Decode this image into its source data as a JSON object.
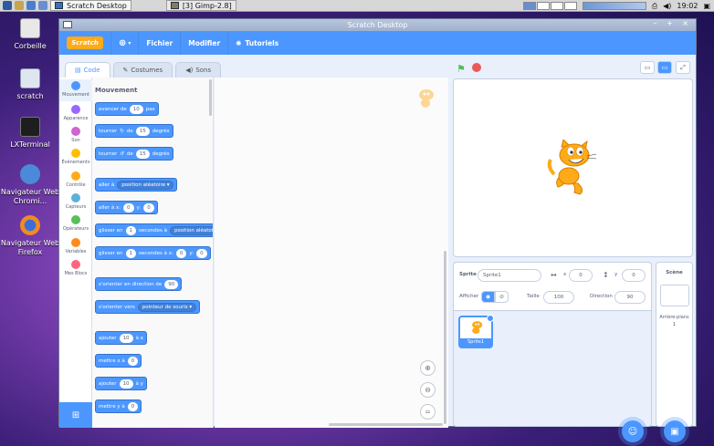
{
  "taskbar": {
    "tasks": [
      "Scratch Desktop",
      "[3] Gimp-2.8]"
    ],
    "clock": "19:02"
  },
  "desktop": {
    "icons": [
      "Corbeille",
      "scratch",
      "LXTerminal",
      "Navigateur Web Chromi...",
      "Navigateur Web Firefox"
    ]
  },
  "window": {
    "title": "Scratch Desktop",
    "controls": "– + ×"
  },
  "menu": {
    "logo": "Scratch",
    "file": "Fichier",
    "edit": "Modifier",
    "tutorials": "Tutoriels"
  },
  "tabs": [
    "Code",
    "Costumes",
    "Sons"
  ],
  "categories": [
    {
      "label": "Mouvement",
      "color": "#4c97ff"
    },
    {
      "label": "Apparence",
      "color": "#9966ff"
    },
    {
      "label": "Son",
      "color": "#cf63cf"
    },
    {
      "label": "Événements",
      "color": "#ffbf00"
    },
    {
      "label": "Contrôle",
      "color": "#ffab19"
    },
    {
      "label": "Capteurs",
      "color": "#5cb1d6"
    },
    {
      "label": "Opérateurs",
      "color": "#59c059"
    },
    {
      "label": "Variables",
      "color": "#ff8c1a"
    },
    {
      "label": "Mes Blocs",
      "color": "#ff6680"
    }
  ],
  "palette": {
    "title": "Mouvement",
    "blocks": {
      "move": [
        "avancer de",
        "10",
        "pas"
      ],
      "turn_right": [
        "tourner",
        "de",
        "15",
        "degrés"
      ],
      "turn_left": [
        "tourner",
        "de",
        "15",
        "degrés"
      ],
      "goto": [
        "aller à",
        "position aléatoire"
      ],
      "goto_xy": [
        "aller à x:",
        "0",
        "y:",
        "0"
      ],
      "glide": [
        "glisser en",
        "1",
        "secondes à",
        "position aléatoire"
      ],
      "glide_xy": [
        "glisser en",
        "1",
        "secondes à x:",
        "0",
        "y:",
        "0"
      ],
      "point_dir": [
        "s'orienter en direction de",
        "90"
      ],
      "point_towards": [
        "s'orienter vers",
        "pointeur de souris"
      ],
      "change_x": [
        "ajouter",
        "10",
        "à x"
      ],
      "set_x": [
        "mettre x à",
        "0"
      ],
      "change_y": [
        "ajouter",
        "10",
        "à y"
      ],
      "set_y": [
        "mettre y à",
        "0"
      ]
    }
  },
  "sprite_info": {
    "sprite_label": "Sprite",
    "sprite_name": "Sprite1",
    "x_label": "x",
    "x": "0",
    "y_label": "y",
    "y": "0",
    "show_label": "Afficher",
    "size_label": "Taille",
    "size": "100",
    "direction_label": "Direction",
    "direction": "90"
  },
  "sprites": [
    "Sprite1"
  ],
  "scene": {
    "title": "Scène",
    "backdrops_label": "Arrière-plans",
    "backdrops_count": "1"
  }
}
